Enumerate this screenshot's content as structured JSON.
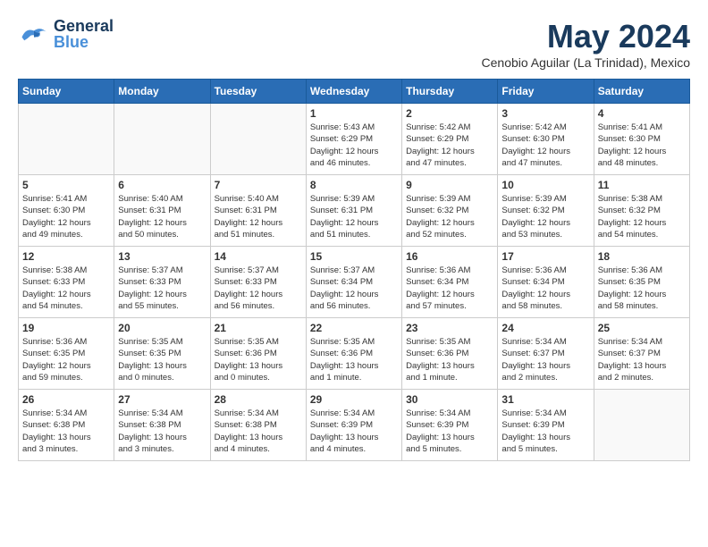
{
  "header": {
    "logo_general": "General",
    "logo_blue": "Blue",
    "month_year": "May 2024",
    "location": "Cenobio Aguilar (La Trinidad), Mexico"
  },
  "days_of_week": [
    "Sunday",
    "Monday",
    "Tuesday",
    "Wednesday",
    "Thursday",
    "Friday",
    "Saturday"
  ],
  "weeks": [
    [
      {
        "day": "",
        "info": "",
        "empty": true
      },
      {
        "day": "",
        "info": "",
        "empty": true
      },
      {
        "day": "",
        "info": "",
        "empty": true
      },
      {
        "day": "1",
        "info": "Sunrise: 5:43 AM\nSunset: 6:29 PM\nDaylight: 12 hours\nand 46 minutes.",
        "empty": false
      },
      {
        "day": "2",
        "info": "Sunrise: 5:42 AM\nSunset: 6:29 PM\nDaylight: 12 hours\nand 47 minutes.",
        "empty": false
      },
      {
        "day": "3",
        "info": "Sunrise: 5:42 AM\nSunset: 6:30 PM\nDaylight: 12 hours\nand 47 minutes.",
        "empty": false
      },
      {
        "day": "4",
        "info": "Sunrise: 5:41 AM\nSunset: 6:30 PM\nDaylight: 12 hours\nand 48 minutes.",
        "empty": false
      }
    ],
    [
      {
        "day": "5",
        "info": "Sunrise: 5:41 AM\nSunset: 6:30 PM\nDaylight: 12 hours\nand 49 minutes.",
        "empty": false
      },
      {
        "day": "6",
        "info": "Sunrise: 5:40 AM\nSunset: 6:31 PM\nDaylight: 12 hours\nand 50 minutes.",
        "empty": false
      },
      {
        "day": "7",
        "info": "Sunrise: 5:40 AM\nSunset: 6:31 PM\nDaylight: 12 hours\nand 51 minutes.",
        "empty": false
      },
      {
        "day": "8",
        "info": "Sunrise: 5:39 AM\nSunset: 6:31 PM\nDaylight: 12 hours\nand 51 minutes.",
        "empty": false
      },
      {
        "day": "9",
        "info": "Sunrise: 5:39 AM\nSunset: 6:32 PM\nDaylight: 12 hours\nand 52 minutes.",
        "empty": false
      },
      {
        "day": "10",
        "info": "Sunrise: 5:39 AM\nSunset: 6:32 PM\nDaylight: 12 hours\nand 53 minutes.",
        "empty": false
      },
      {
        "day": "11",
        "info": "Sunrise: 5:38 AM\nSunset: 6:32 PM\nDaylight: 12 hours\nand 54 minutes.",
        "empty": false
      }
    ],
    [
      {
        "day": "12",
        "info": "Sunrise: 5:38 AM\nSunset: 6:33 PM\nDaylight: 12 hours\nand 54 minutes.",
        "empty": false
      },
      {
        "day": "13",
        "info": "Sunrise: 5:37 AM\nSunset: 6:33 PM\nDaylight: 12 hours\nand 55 minutes.",
        "empty": false
      },
      {
        "day": "14",
        "info": "Sunrise: 5:37 AM\nSunset: 6:33 PM\nDaylight: 12 hours\nand 56 minutes.",
        "empty": false
      },
      {
        "day": "15",
        "info": "Sunrise: 5:37 AM\nSunset: 6:34 PM\nDaylight: 12 hours\nand 56 minutes.",
        "empty": false
      },
      {
        "day": "16",
        "info": "Sunrise: 5:36 AM\nSunset: 6:34 PM\nDaylight: 12 hours\nand 57 minutes.",
        "empty": false
      },
      {
        "day": "17",
        "info": "Sunrise: 5:36 AM\nSunset: 6:34 PM\nDaylight: 12 hours\nand 58 minutes.",
        "empty": false
      },
      {
        "day": "18",
        "info": "Sunrise: 5:36 AM\nSunset: 6:35 PM\nDaylight: 12 hours\nand 58 minutes.",
        "empty": false
      }
    ],
    [
      {
        "day": "19",
        "info": "Sunrise: 5:36 AM\nSunset: 6:35 PM\nDaylight: 12 hours\nand 59 minutes.",
        "empty": false
      },
      {
        "day": "20",
        "info": "Sunrise: 5:35 AM\nSunset: 6:35 PM\nDaylight: 13 hours\nand 0 minutes.",
        "empty": false
      },
      {
        "day": "21",
        "info": "Sunrise: 5:35 AM\nSunset: 6:36 PM\nDaylight: 13 hours\nand 0 minutes.",
        "empty": false
      },
      {
        "day": "22",
        "info": "Sunrise: 5:35 AM\nSunset: 6:36 PM\nDaylight: 13 hours\nand 1 minute.",
        "empty": false
      },
      {
        "day": "23",
        "info": "Sunrise: 5:35 AM\nSunset: 6:36 PM\nDaylight: 13 hours\nand 1 minute.",
        "empty": false
      },
      {
        "day": "24",
        "info": "Sunrise: 5:34 AM\nSunset: 6:37 PM\nDaylight: 13 hours\nand 2 minutes.",
        "empty": false
      },
      {
        "day": "25",
        "info": "Sunrise: 5:34 AM\nSunset: 6:37 PM\nDaylight: 13 hours\nand 2 minutes.",
        "empty": false
      }
    ],
    [
      {
        "day": "26",
        "info": "Sunrise: 5:34 AM\nSunset: 6:38 PM\nDaylight: 13 hours\nand 3 minutes.",
        "empty": false
      },
      {
        "day": "27",
        "info": "Sunrise: 5:34 AM\nSunset: 6:38 PM\nDaylight: 13 hours\nand 3 minutes.",
        "empty": false
      },
      {
        "day": "28",
        "info": "Sunrise: 5:34 AM\nSunset: 6:38 PM\nDaylight: 13 hours\nand 4 minutes.",
        "empty": false
      },
      {
        "day": "29",
        "info": "Sunrise: 5:34 AM\nSunset: 6:39 PM\nDaylight: 13 hours\nand 4 minutes.",
        "empty": false
      },
      {
        "day": "30",
        "info": "Sunrise: 5:34 AM\nSunset: 6:39 PM\nDaylight: 13 hours\nand 5 minutes.",
        "empty": false
      },
      {
        "day": "31",
        "info": "Sunrise: 5:34 AM\nSunset: 6:39 PM\nDaylight: 13 hours\nand 5 minutes.",
        "empty": false
      },
      {
        "day": "",
        "info": "",
        "empty": true
      }
    ]
  ]
}
